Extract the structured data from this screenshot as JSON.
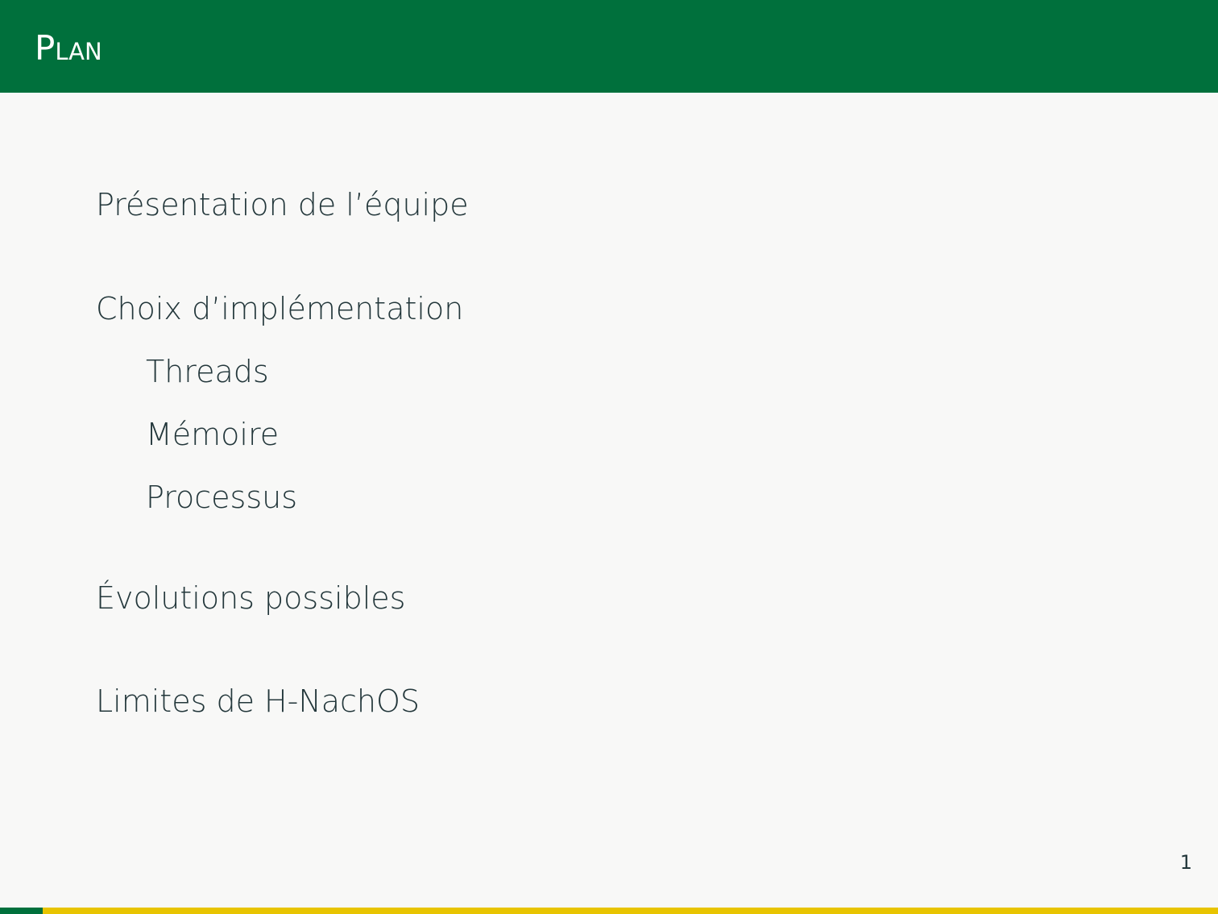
{
  "slide": {
    "title": "Plan",
    "page_number": "1"
  },
  "toc": {
    "sections": [
      {
        "label": "Présentation de l’équipe"
      },
      {
        "label": "Choix d’implémentation",
        "subsections": [
          {
            "label": "Threads"
          },
          {
            "label": "Mémoire"
          },
          {
            "label": "Processus"
          }
        ]
      },
      {
        "label": "Évolutions possibles"
      },
      {
        "label": "Limites de H-NachOS"
      }
    ]
  },
  "progress": {
    "fraction": 0.035
  },
  "colors": {
    "header_background": "#00703c",
    "text": "#23373b",
    "background": "#f8f8f7",
    "progress_fill": "#00703c",
    "progress_track": "#e8c400"
  }
}
